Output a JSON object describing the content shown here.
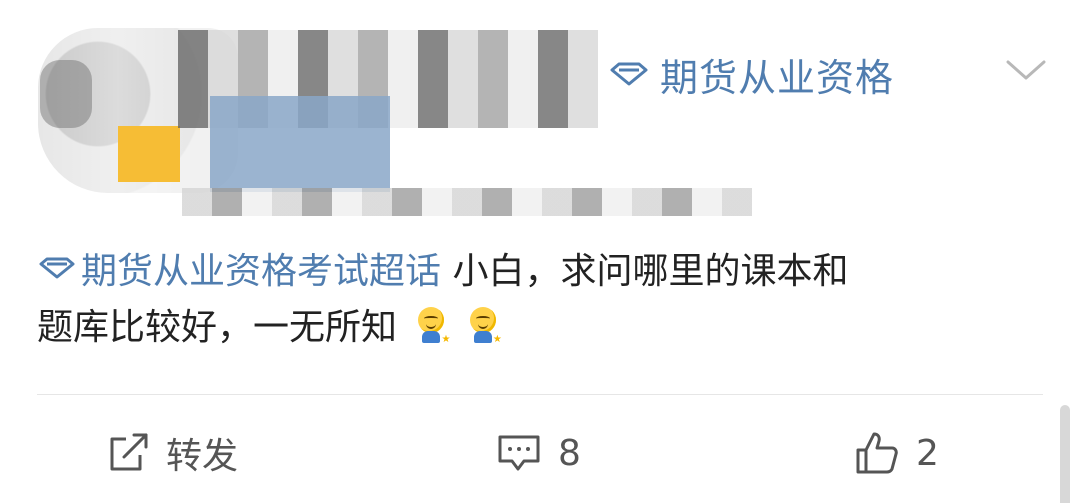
{
  "post": {
    "supertopic_tag": "期货从业资格",
    "content": {
      "topic": "期货从业资格考试超话",
      "text_line1": " 小白，求问哪里的课本和",
      "text_line2": "题库比较好，一无所知"
    },
    "emojis": [
      "grin-sitting-emoji",
      "grin-sitting-emoji"
    ]
  },
  "actions": {
    "repost_label": "转发",
    "comment_count": "8",
    "like_count": "2"
  },
  "colors": {
    "link": "#507daf",
    "text": "#222222",
    "icon": "#555555",
    "divider": "#e6e6e6"
  },
  "icons": {
    "supertopic": "diamond-icon",
    "expand": "chevron-down-icon",
    "repost": "repost-icon",
    "comment": "comment-icon",
    "like": "thumbs-up-icon"
  }
}
